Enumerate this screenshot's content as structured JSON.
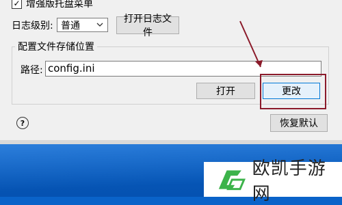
{
  "options": {
    "enhanced_tray_menu": {
      "label": "增强版托盘菜单",
      "checked": true
    }
  },
  "log": {
    "label": "日志级别:",
    "level_value": "普通",
    "open_log_button": "打开日志文件"
  },
  "config": {
    "group_title": "配置文件存储位置",
    "path_label": "路径:",
    "path_value": "config.ini",
    "open_button": "打开",
    "change_button": "更改"
  },
  "footer": {
    "help_glyph": "?",
    "reset_button": "恢复默认"
  },
  "watermark": {
    "text": "欧凯手游网"
  },
  "colors": {
    "annotation": "#8b1a2a",
    "desktop": "#0a63c9",
    "logo_green": "#3cb34a"
  },
  "icons": {
    "checkbox": "check-mark-icon",
    "select": "chevron-down-icon",
    "help": "help-circle-icon",
    "logo": "watermark-logo-icon"
  }
}
